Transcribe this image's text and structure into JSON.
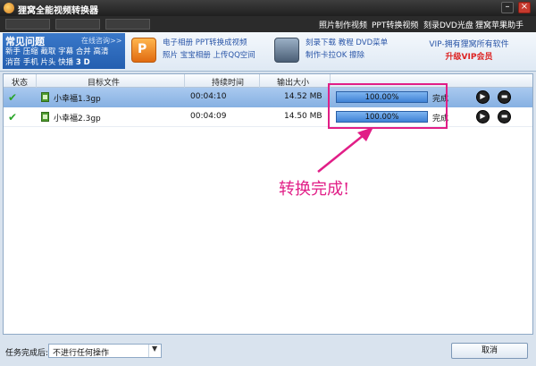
{
  "window": {
    "title": "狸窝全能视频转换器"
  },
  "menubar": {
    "items": [
      "照片制作视频",
      "PPT转换视频",
      "刻录DVD光盘",
      "狸窝苹果助手"
    ]
  },
  "banner": {
    "faq_title": "常见问题",
    "faq_more": "在线咨询>>",
    "faq_row1": "新手 压缩 截取 字幕 合并 高清",
    "faq_row2": "消音 手机 片头 快播",
    "faq_3d": "3 D",
    "ad1_line1": "电子相册 PPT转换成视频",
    "ad1_line2": "照片 宝宝相册 上传QQ空间",
    "ad2_line1": "刻录下载 教程 DVD菜单",
    "ad2_line2": "制作卡拉OK 擦除",
    "vip_text": "VIP-拥有狸窝所有软件",
    "vip_link": "升级VIP会员"
  },
  "table": {
    "headers": [
      "状态",
      "目标文件",
      "持续时间",
      "输出大小"
    ],
    "rows": [
      {
        "file": "小幸福1.3gp",
        "duration": "00:04:10",
        "size": "14.52 MB",
        "progress": "100.00%",
        "progress_value": 100,
        "status": "完成"
      },
      {
        "file": "小幸福2.3gp",
        "duration": "00:04:09",
        "size": "14.50 MB",
        "progress": "100.00%",
        "progress_value": 100,
        "status": "完成"
      }
    ]
  },
  "annotation": {
    "text": "转换完成!",
    "color": "#e11e87"
  },
  "bottom": {
    "label": "任务完成后:",
    "select_value": "不进行任何操作",
    "cancel_label": "取消"
  }
}
